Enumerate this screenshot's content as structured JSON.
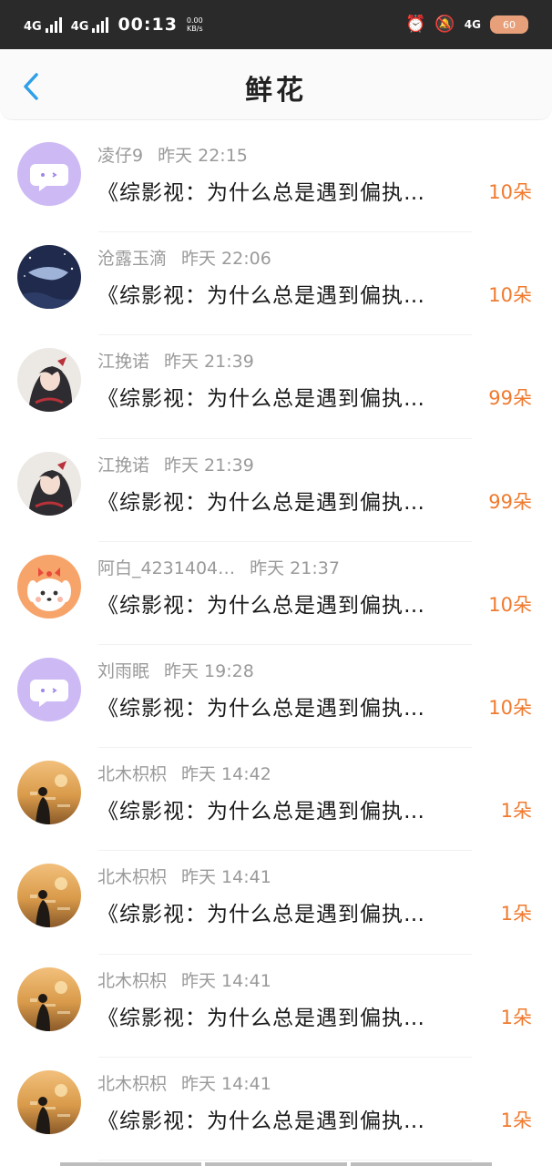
{
  "status_bar": {
    "net1": "4G",
    "net2": "4G",
    "time": "00:13",
    "speed_value": "0.00",
    "speed_unit": "KB/s",
    "net3": "4G",
    "battery": "60"
  },
  "header": {
    "title": "鲜花"
  },
  "colors": {
    "accent": "#2f9fe8",
    "count": "#f07a2e"
  },
  "gifts": [
    {
      "user": "凌仔9",
      "time": "昨天 22:15",
      "book": "《综影视：为什么总是遇到偏执…",
      "count": "10朵",
      "avatar": "chat-bubble"
    },
    {
      "user": "沧露玉滴",
      "time": "昨天 22:06",
      "book": "《综影视：为什么总是遇到偏执…",
      "count": "10朵",
      "avatar": "whale-night"
    },
    {
      "user": "江挽诺",
      "time": "昨天 21:39",
      "book": "《综影视：为什么总是遇到偏执…",
      "count": "99朵",
      "avatar": "anime-girl"
    },
    {
      "user": "江挽诺",
      "time": "昨天 21:39",
      "book": "《综影视：为什么总是遇到偏执…",
      "count": "99朵",
      "avatar": "anime-girl"
    },
    {
      "user": "阿白_4231404…",
      "time": "昨天 21:37",
      "book": "《综影视：为什么总是遇到偏执…",
      "count": "10朵",
      "avatar": "cartoon-dog"
    },
    {
      "user": "刘雨眠",
      "time": "昨天 19:28",
      "book": "《综影视：为什么总是遇到偏执…",
      "count": "10朵",
      "avatar": "chat-bubble"
    },
    {
      "user": "北木枳枳",
      "time": "昨天 14:42",
      "book": "《综影视：为什么总是遇到偏执…",
      "count": "1朵",
      "avatar": "sunset-girl"
    },
    {
      "user": "北木枳枳",
      "time": "昨天 14:41",
      "book": "《综影视：为什么总是遇到偏执…",
      "count": "1朵",
      "avatar": "sunset-girl"
    },
    {
      "user": "北木枳枳",
      "time": "昨天 14:41",
      "book": "《综影视：为什么总是遇到偏执…",
      "count": "1朵",
      "avatar": "sunset-girl"
    },
    {
      "user": "北木枳枳",
      "time": "昨天 14:41",
      "book": "《综影视：为什么总是遇到偏执…",
      "count": "1朵",
      "avatar": "sunset-girl"
    }
  ]
}
